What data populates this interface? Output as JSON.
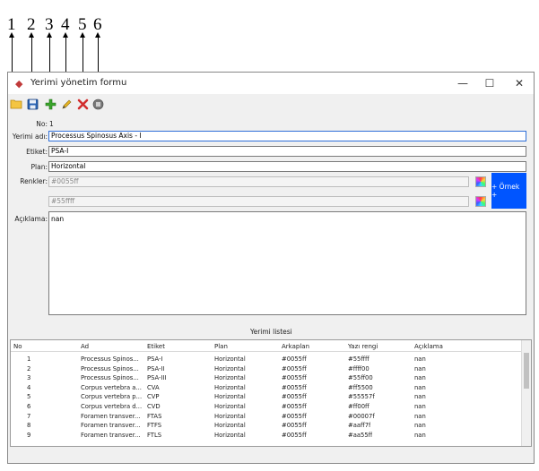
{
  "callouts": [
    "1",
    "2",
    "3",
    "4",
    "5",
    "6"
  ],
  "window": {
    "title": "Yerimi yönetim formu",
    "minimize": "—",
    "maximize": "☐",
    "close": "✕"
  },
  "toolbar": {
    "open": "folder-icon",
    "save": "save-icon",
    "add": "add-icon",
    "edit": "edit-icon",
    "delete": "delete-icon",
    "stop": "stop-icon"
  },
  "form": {
    "no_label": "No:",
    "no_value": "1",
    "name_label": "Yerimi adı:",
    "name_value": "Processus Spinosus Axis - I",
    "tag_label": "Etiket:",
    "tag_value": "PSA-I",
    "plane_label": "Plan:",
    "plane_value": "Horizontal",
    "colors_label": "Renkler:",
    "bg_color_value": "#0055ff",
    "fg_color_value": "#55ffff",
    "sample_label": "+ Örnek +",
    "sample_bg": "#0055ff",
    "desc_label": "Açıklama:",
    "desc_value": "nan"
  },
  "list": {
    "title": "Yerimi listesi",
    "columns": [
      "No",
      "Ad",
      "Etiket",
      "Plan",
      "Arkaplan",
      "Yazı rengi",
      "Açıklama"
    ],
    "rows": [
      [
        "1",
        "Processus Spinos...",
        "PSA-I",
        "Horizontal",
        "#0055ff",
        "#55ffff",
        "nan"
      ],
      [
        "2",
        "Processus Spinos...",
        "PSA-II",
        "Horizontal",
        "#0055ff",
        "#ffff00",
        "nan"
      ],
      [
        "3",
        "Processus Spinos...",
        "PSA-III",
        "Horizontal",
        "#0055ff",
        "#55ff00",
        "nan"
      ],
      [
        "4",
        "Corpus vertebra a...",
        "CVA",
        "Horizontal",
        "#0055ff",
        "#ff5500",
        "nan"
      ],
      [
        "5",
        "Corpus vertebra p...",
        "CVP",
        "Horizontal",
        "#0055ff",
        "#55557f",
        "nan"
      ],
      [
        "6",
        "Corpus vertebra d...",
        "CVD",
        "Horizontal",
        "#0055ff",
        "#ff00ff",
        "nan"
      ],
      [
        "7",
        "Foramen transver...",
        "FTAS",
        "Horizontal",
        "#0055ff",
        "#00007f",
        "nan"
      ],
      [
        "8",
        "Foramen transver...",
        "FTFS",
        "Horizontal",
        "#0055ff",
        "#aaff7f",
        "nan"
      ],
      [
        "9",
        "Foramen transver...",
        "FTLS",
        "Horizontal",
        "#0055ff",
        "#aa55ff",
        "nan"
      ]
    ]
  }
}
